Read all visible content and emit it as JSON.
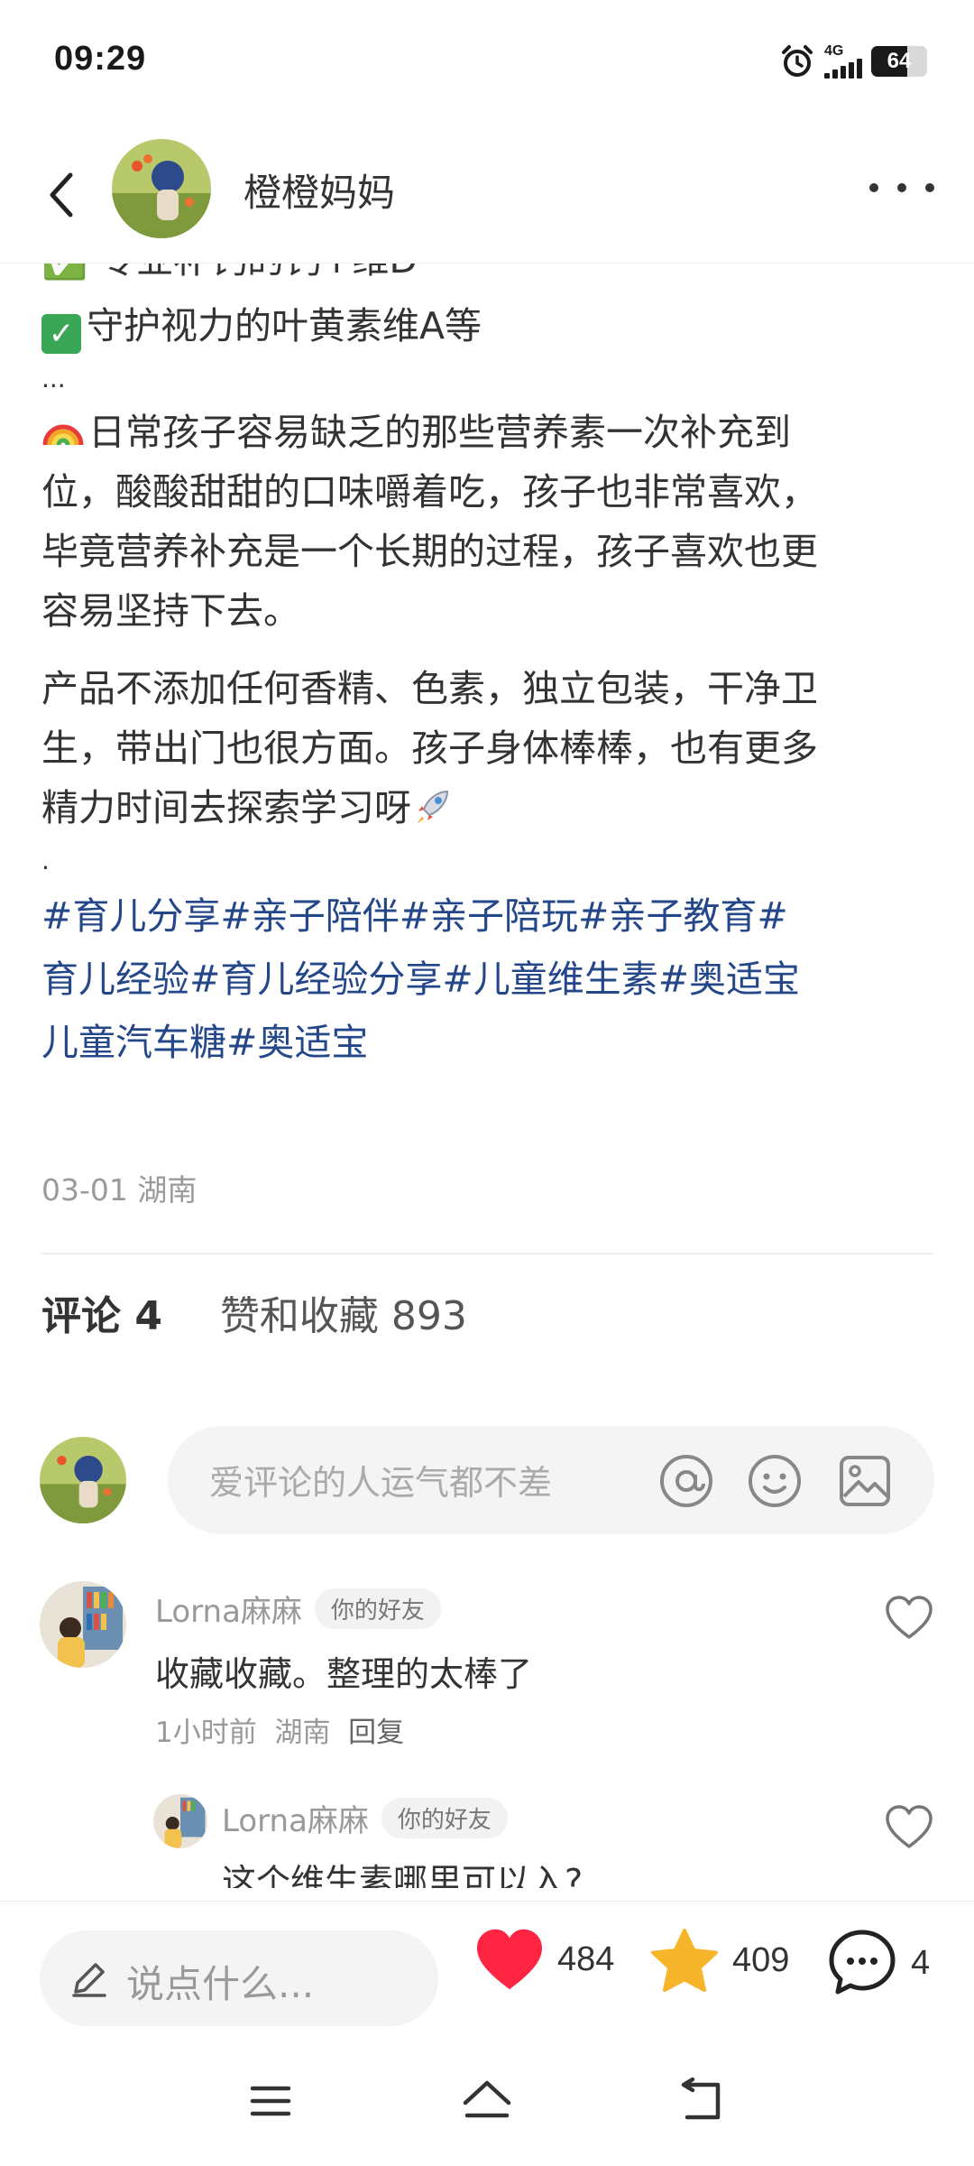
{
  "status_bar": {
    "time": "09:29",
    "network": "4G",
    "battery": "64",
    "battery_level": 0.64
  },
  "header": {
    "author_name": "橙橙妈妈"
  },
  "post": {
    "clipped_line": "✅ 专业补钙的钙+维D",
    "lines": [
      {
        "type": "check",
        "text": "守护视力的叶黄素维A等"
      },
      {
        "type": "plain",
        "text": "..."
      },
      {
        "type": "rainbow",
        "text": "日常孩子容易缺乏的那些营养素一次补充到"
      },
      {
        "type": "plain",
        "text": "位，酸酸甜甜的口味嚼着吃，孩子也非常喜欢，"
      },
      {
        "type": "plain",
        "text": "毕竟营养补充是一个长期的过程，孩子喜欢也更"
      },
      {
        "type": "plain",
        "text": "容易坚持下去。"
      }
    ],
    "paragraph2": [
      "产品不添加任何香精、色素，独立包装，干净卫",
      "生，带出门也很方面。孩子身体棒棒，也有更多",
      "精力时间去探索学习呀"
    ],
    "dot": ".",
    "tag_lines": [
      "#育儿分享#亲子陪伴#亲子陪玩#亲子教育#",
      "育儿经验#育儿经验分享#儿童维生素#奥适宝",
      "儿童汽车糖#奥适宝"
    ],
    "date": "03-01",
    "location": "湖南"
  },
  "stats": {
    "comments_label": "评论 4",
    "likes_label": "赞和收藏 893"
  },
  "composer": {
    "placeholder": "爱评论的人运气都不差"
  },
  "comments": [
    {
      "user": "Lorna麻麻",
      "badge": "你的好友",
      "text": "收藏收藏。整理的太棒了",
      "time": "1小时前",
      "location": "湖南",
      "reply": "回复"
    },
    {
      "user": "Lorna麻麻",
      "badge": "你的好友",
      "text": "这个维生素哪里可以入?"
    }
  ],
  "bottom_bar": {
    "say_placeholder": "说点什么...",
    "likes": "484",
    "collects": "409",
    "comments": "4"
  },
  "colors": {
    "accent_like": "#ff2442",
    "accent_star": "#f7b52c",
    "tag": "#24478a"
  }
}
